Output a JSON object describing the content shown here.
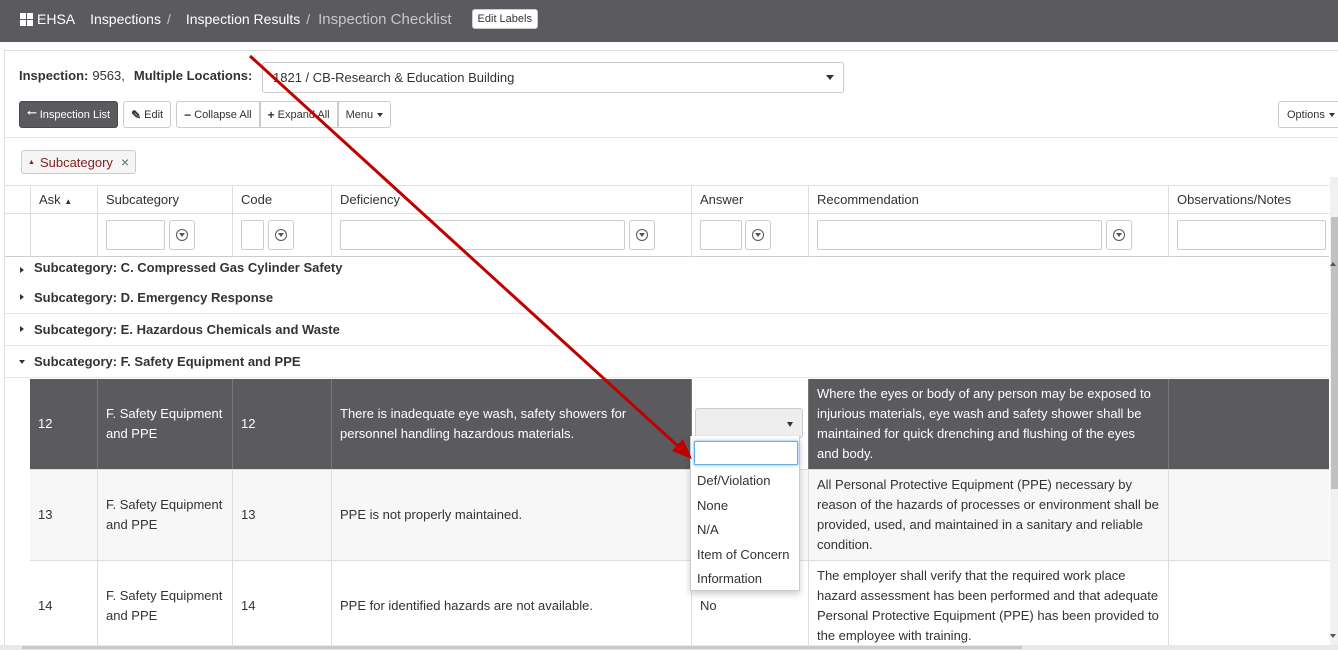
{
  "nav": {
    "brand": "EHSA",
    "crumb1": "Inspections",
    "crumb2": "Inspection Results",
    "separator": "/",
    "current": "Inspection Checklist",
    "edit_labels": "Edit Labels"
  },
  "inspection": {
    "label": "Inspection:",
    "number": "9563,",
    "locations_label": "Multiple Locations:",
    "location_value": "1821 / CB-Research & Education Building"
  },
  "toolbar": {
    "inspection_list": "Inspection List",
    "edit": "Edit",
    "collapse_all": "Collapse All",
    "expand_all": "Expand All",
    "menu": "Menu",
    "options": "Options"
  },
  "group_chip": "Subcategory",
  "columns": {
    "ask": "Ask",
    "subcategory": "Subcategory",
    "code": "Code",
    "deficiency": "Deficiency",
    "answer": "Answer",
    "recommendation": "Recommendation",
    "observations": "Observations/Notes"
  },
  "groups": [
    "Subcategory: C. Compressed Gas Cylinder Safety",
    "Subcategory: D. Emergency Response",
    "Subcategory: E. Hazardous Chemicals and Waste",
    "Subcategory: F. Safety Equipment and PPE"
  ],
  "rows": [
    {
      "ask": "12",
      "subcategory": "F. Safety Equipment and PPE",
      "code": "12",
      "deficiency": "There is inadequate eye wash, safety showers for personnel handling hazardous materials.",
      "answer": "",
      "recommendation": "Where the eyes or body of any person may be exposed to injurious materials, eye wash and safety shower shall be maintained for quick drenching and flushing of the eyes and body.",
      "observations": ""
    },
    {
      "ask": "13",
      "subcategory": "F. Safety Equipment and PPE",
      "code": "13",
      "deficiency": "PPE is not properly maintained.",
      "answer": "",
      "recommendation": "All Personal Protective Equipment (PPE) necessary by reason of the hazards of processes or environment shall be provided, used, and maintained in a sanitary and reliable condition.",
      "observations": ""
    },
    {
      "ask": "14",
      "subcategory": "F. Safety Equipment and PPE",
      "code": "14",
      "deficiency": "PPE for identified hazards are not available.",
      "answer": "No",
      "recommendation": "The employer shall verify that the required work place hazard assessment has been performed and that adequate Personal Protective Equipment (PPE) has been provided to the employee with training.",
      "observations": ""
    }
  ],
  "answer_options": [
    "Def/Violation",
    "None",
    "N/A",
    "Item of Concern",
    "Information"
  ],
  "colors": {
    "navbar": "#5b5b5f",
    "selected_row": "#5b5b5f",
    "annotation_arrow": "#c00000",
    "chip_text": "#8b1a1a"
  }
}
